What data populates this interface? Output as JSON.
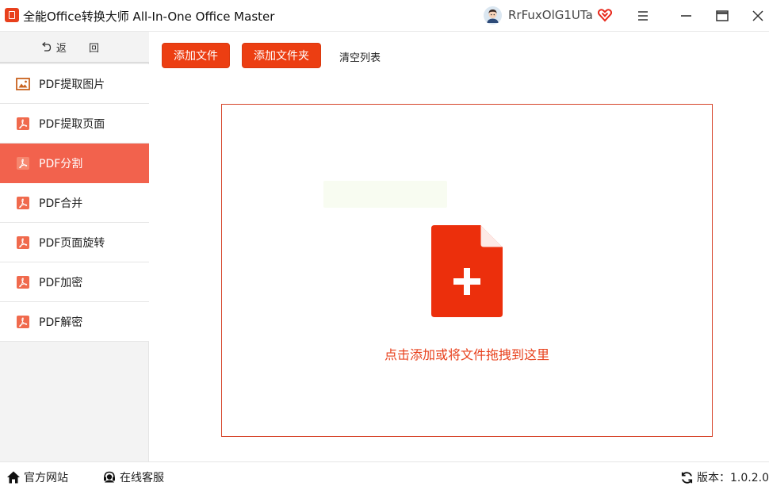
{
  "app": {
    "title": "全能Office转换大师 All-In-One Office Master",
    "logo_icon": "app-logo-icon",
    "accent_color": "#ec3e12"
  },
  "user": {
    "name": "RrFuxOlG1UTa",
    "avatar_icon": "user-avatar-icon",
    "vip_icon": "vip-heart-icon"
  },
  "window_controls": [
    "menu-icon",
    "minimize-icon",
    "maximize-icon",
    "close-icon"
  ],
  "sidebar": {
    "back_label": "返 回",
    "items": [
      {
        "label": "PDF提取图片",
        "icon": "image-icon",
        "active": false
      },
      {
        "label": "PDF提取页面",
        "icon": "pdf-icon",
        "active": false
      },
      {
        "label": "PDF分割",
        "icon": "pdf-icon",
        "active": true
      },
      {
        "label": "PDF合并",
        "icon": "pdf-icon",
        "active": false
      },
      {
        "label": "PDF页面旋转",
        "icon": "pdf-icon",
        "active": false
      },
      {
        "label": "PDF加密",
        "icon": "pdf-icon",
        "active": false
      },
      {
        "label": "PDF解密",
        "icon": "pdf-icon",
        "active": false
      }
    ]
  },
  "toolbar": {
    "add_file_label": "添加文件",
    "add_folder_label": "添加文件夹",
    "clear_list_label": "清空列表"
  },
  "dropzone": {
    "hint": "点击添加或将文件拖拽到这里",
    "icon": "add-file-icon"
  },
  "footer": {
    "website_label": "官方网站",
    "service_label": "在线客服",
    "version_label": "版本：1.0.2.0"
  }
}
